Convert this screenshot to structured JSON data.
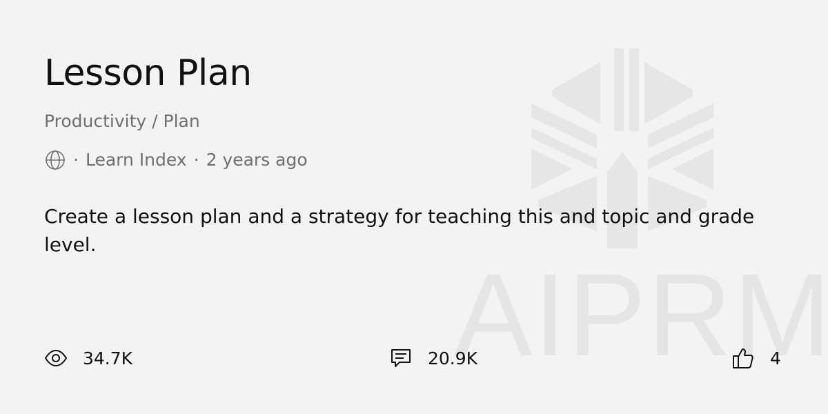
{
  "prompt": {
    "title": "Lesson Plan",
    "category": "Productivity / Plan",
    "visibility_icon": "globe-icon",
    "author": "Learn Index",
    "separator": "·",
    "age": "2 years ago",
    "description": "Create a lesson plan and a strategy for teaching this and topic and grade level."
  },
  "stats": {
    "views": {
      "icon": "eye-icon",
      "value": "34.7K"
    },
    "comments": {
      "icon": "comment-icon",
      "value": "20.9K"
    },
    "likes": {
      "icon": "thumbs-up-icon",
      "value": "4"
    }
  },
  "watermark": {
    "text": "AIPRM"
  },
  "colors": {
    "background": "#f3f3f3",
    "text": "#111111",
    "muted": "#6f6f6f",
    "watermark": "#e5e5e5"
  }
}
